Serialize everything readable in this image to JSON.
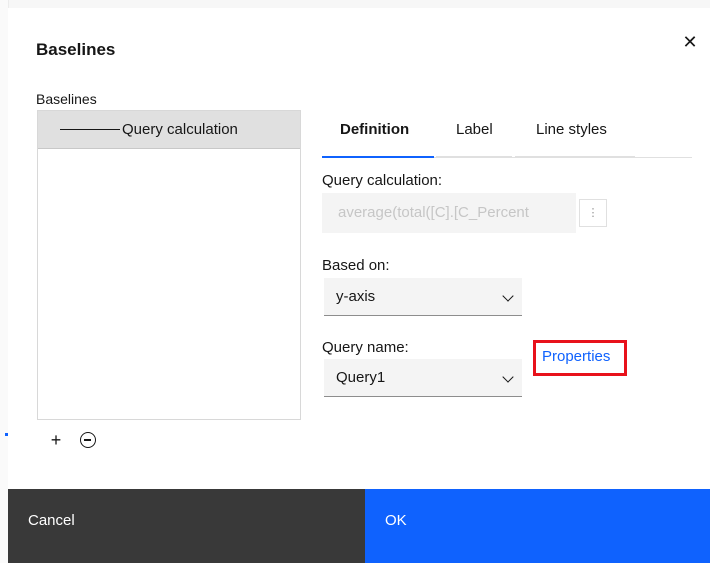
{
  "dialog": {
    "title": "Baselines",
    "close_icon": "close-icon"
  },
  "baselines": {
    "label": "Baselines",
    "items": [
      {
        "label": "Query calculation",
        "selected": true
      }
    ],
    "add_icon": "plus-icon",
    "remove_icon": "minus-circle-icon"
  },
  "tabs": [
    {
      "label": "Definition",
      "active": true
    },
    {
      "label": "Label",
      "active": false
    },
    {
      "label": "Line styles",
      "active": false
    }
  ],
  "definition": {
    "query_calculation": {
      "label": "Query calculation:",
      "value": "average(total([C].[C_Percent",
      "disabled": true,
      "more_icon": "overflow-menu-icon"
    },
    "based_on": {
      "label": "Based on:",
      "value": "y-axis"
    },
    "query_name": {
      "label": "Query name:",
      "value": "Query1"
    },
    "properties_link": "Properties"
  },
  "footer": {
    "cancel_label": "Cancel",
    "ok_label": "OK"
  },
  "colors": {
    "accent": "#0f62fe",
    "cancel_bg": "#393939",
    "highlight": "#e8111b"
  }
}
